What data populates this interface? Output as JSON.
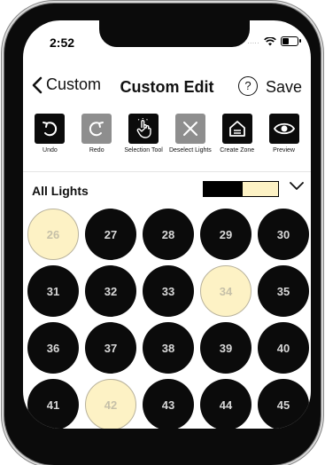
{
  "status_bar": {
    "time": "2:52",
    "signal": "....."
  },
  "nav": {
    "back_label": "Custom",
    "title": "Custom Edit",
    "help_label": "?",
    "save_label": "Save"
  },
  "toolbar": [
    {
      "name": "undo",
      "label": "Undo",
      "icon": "undo-icon",
      "disabled": false
    },
    {
      "name": "redo",
      "label": "Redo",
      "icon": "redo-icon",
      "disabled": true
    },
    {
      "name": "selection-tool",
      "label": "Selection Tool",
      "icon": "pointer-hand-icon",
      "disabled": false
    },
    {
      "name": "deselect-lights",
      "label": "Deselect Lights",
      "icon": "close-icon",
      "disabled": true
    },
    {
      "name": "create-zone",
      "label": "Create Zone",
      "icon": "house-icon",
      "disabled": false
    },
    {
      "name": "preview",
      "label": "Preview",
      "icon": "eye-icon",
      "disabled": false
    }
  ],
  "filter": {
    "label": "All Lights",
    "swatch_colors": [
      "#000000",
      "#fdf2c5"
    ]
  },
  "lights": [
    {
      "number": "26",
      "selected": true
    },
    {
      "number": "27",
      "selected": false
    },
    {
      "number": "28",
      "selected": false
    },
    {
      "number": "29",
      "selected": false
    },
    {
      "number": "30",
      "selected": false
    },
    {
      "number": "31",
      "selected": false
    },
    {
      "number": "32",
      "selected": false
    },
    {
      "number": "33",
      "selected": false
    },
    {
      "number": "34",
      "selected": true
    },
    {
      "number": "35",
      "selected": false
    },
    {
      "number": "36",
      "selected": false
    },
    {
      "number": "37",
      "selected": false
    },
    {
      "number": "38",
      "selected": false
    },
    {
      "number": "39",
      "selected": false
    },
    {
      "number": "40",
      "selected": false
    },
    {
      "number": "41",
      "selected": false
    },
    {
      "number": "42",
      "selected": true
    },
    {
      "number": "43",
      "selected": false
    },
    {
      "number": "44",
      "selected": false
    },
    {
      "number": "45",
      "selected": false
    }
  ],
  "colors": {
    "selected_fill": "#fdf2c5",
    "unselected_fill": "#0b0b0b",
    "disabled_button": "#8e8e8e"
  }
}
